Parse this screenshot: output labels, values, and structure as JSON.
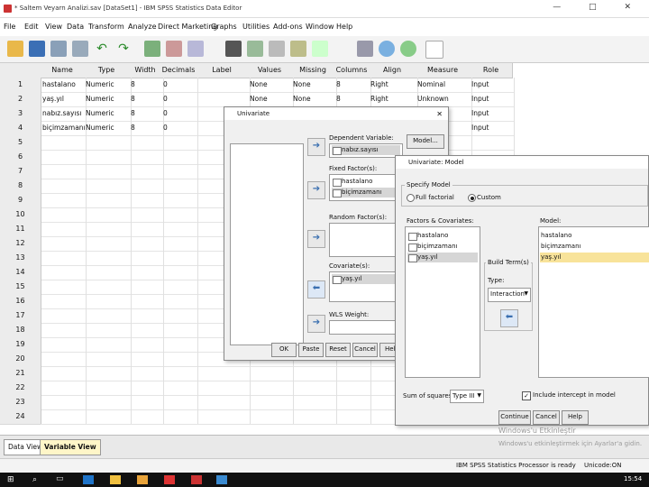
{
  "window": {
    "title": "* Saltem Veyarn Analizi.sav [DataSet1] - IBM SPSS Statistics Data Editor",
    "controls": "—  □  ✕"
  },
  "menu": [
    "File",
    "Edit",
    "View",
    "Data",
    "Transform",
    "Analyze",
    "Direct Marketing",
    "Graphs",
    "Utilities",
    "Add-ons",
    "Window",
    "Help"
  ],
  "grid": {
    "columns": [
      "Name",
      "Type",
      "Width",
      "Decimals",
      "Label",
      "Values",
      "Missing",
      "Columns",
      "Align",
      "Measure",
      "Role"
    ],
    "rows": [
      [
        "hastalano",
        "Numeric",
        "8",
        "0",
        "",
        "None",
        "None",
        "8",
        "Right",
        "Nominal",
        "Input"
      ],
      [
        "yaş.yıl",
        "Numeric",
        "8",
        "0",
        "",
        "None",
        "None",
        "8",
        "Right",
        "Unknown",
        "Input"
      ],
      [
        "nabız.sayısı",
        "Numeric",
        "8",
        "0",
        "",
        "None",
        "None",
        "8",
        "Right",
        "",
        "Input"
      ],
      [
        "biçimzamanı",
        "Numeric",
        "8",
        "0",
        "",
        "None",
        "None",
        "8",
        "",
        "",
        "Input"
      ]
    ],
    "row_numbers": [
      "1",
      "2",
      "3",
      "4",
      "5",
      "6",
      "7",
      "8",
      "9",
      "10",
      "11",
      "12",
      "13",
      "14",
      "15",
      "16",
      "17",
      "18",
      "19",
      "20",
      "21",
      "22",
      "23",
      "24"
    ]
  },
  "tabs": {
    "data_view": "Data View",
    "variable_view": "Variable View"
  },
  "status": {
    "processor": "IBM SPSS Statistics Processor is ready",
    "unicode": "Unicode:ON"
  },
  "watermark": {
    "line1": "Windows'u Etkinleştir",
    "line2": "Windows'u etkinleştirmek için Ayarlar'a gidin."
  },
  "taskbar": {
    "time": "15:54"
  },
  "univariate": {
    "title": "Univariate",
    "dependent_label": "Dependent Variable:",
    "dependent_value": "nabız.sayısı",
    "fixed_label": "Fixed Factor(s):",
    "fixed_items": [
      "hastalano",
      "biçimzamanı"
    ],
    "random_label": "Random Factor(s):",
    "covariate_label": "Covariate(s):",
    "covariate_items": [
      "yaş.yıl"
    ],
    "wls_label": "WLS Weight:",
    "model_button": "Model...",
    "buttons": [
      "OK",
      "Paste",
      "Reset",
      "Cancel",
      "Help"
    ]
  },
  "model": {
    "title": "Univariate: Model",
    "specify_label": "Specify Model",
    "full_factorial": "Full factorial",
    "custom": "Custom",
    "factors_label": "Factors & Covariates:",
    "factors": [
      "hastalano",
      "biçimzamanı",
      "yaş.yıl"
    ],
    "model_label": "Model:",
    "model_items": [
      "hastalano",
      "biçimzamanı",
      "yaş.yıl"
    ],
    "build_term_label": "Build Term(s)",
    "type_label": "Type:",
    "type_value": "Interaction",
    "sum_squares_label": "Sum of squares:",
    "sum_squares_value": "Type III",
    "include_intercept": "Include intercept in model",
    "buttons": [
      "Continue",
      "Cancel",
      "Help"
    ]
  },
  "colors": {
    "selected": "#f8e39a",
    "header": "#ececec",
    "accent": "#3a6fb0"
  }
}
